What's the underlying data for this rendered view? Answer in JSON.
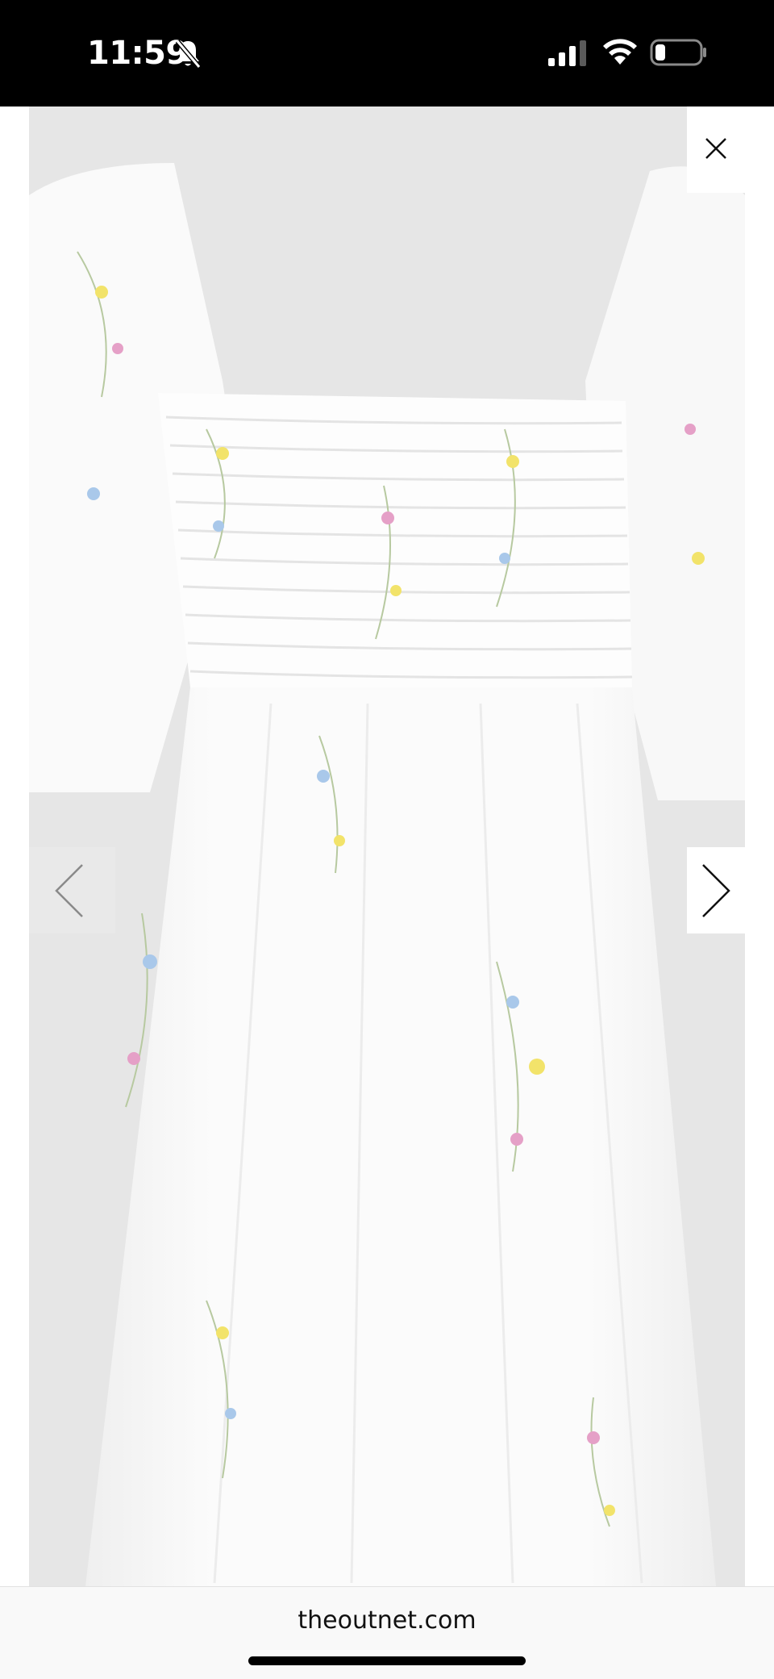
{
  "status_bar": {
    "time": "11:59",
    "icons": [
      "bell-slash-icon",
      "cellular-signal-icon",
      "wifi-icon",
      "battery-icon"
    ],
    "background": "#000000",
    "foreground": "#ffffff"
  },
  "viewer": {
    "image_subject": "white floral smocked puff-sleeve mini dress",
    "controls": {
      "close_icon": "close-icon",
      "prev_icon": "chevron-left-icon",
      "next_icon": "chevron-right-icon"
    },
    "image_background": "#e6e6e6"
  },
  "browser": {
    "url": "theoutnet.com"
  }
}
